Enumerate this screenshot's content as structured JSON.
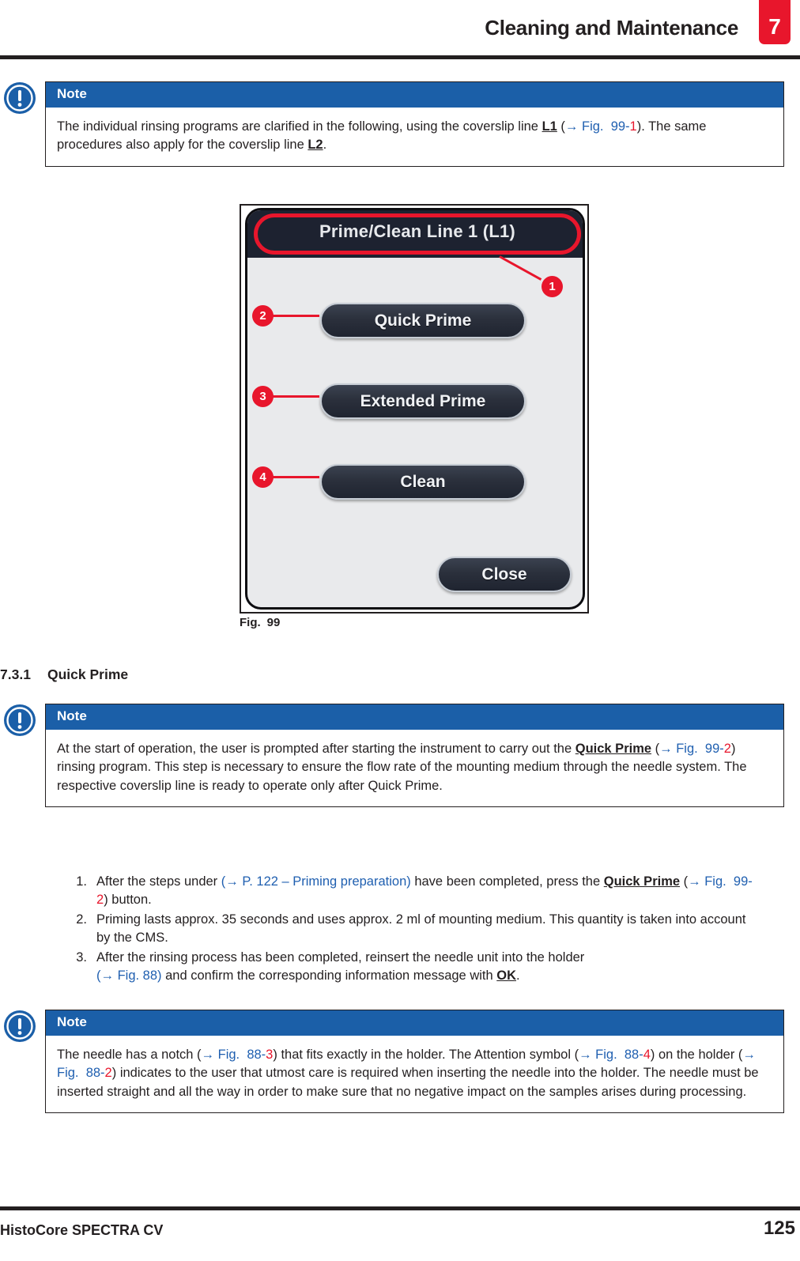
{
  "header": {
    "title": "Cleaning and Maintenance",
    "chapter_number": "7",
    "accent_red": "#e8162c"
  },
  "note_1": {
    "icon": "note-info-icon",
    "label": "Note",
    "text_parts": {
      "p1": "The individual rinsing programs are clarified in the following, using the coverslip line ",
      "bold1": "L1",
      "p2": " (",
      "xref1_arrow": "→ Fig.",
      "xref1_fig": "99-",
      "xref1_num": "1",
      "p3": "). The same procedures also apply for the coverslip line ",
      "bold2": "L2",
      "p4": "."
    }
  },
  "figure": {
    "caption_label": "Fig.",
    "caption_number": "99",
    "dialog": {
      "title": "Prime/Clean Line 1 (L1)",
      "buttons": [
        {
          "label": "Quick Prime",
          "callout": "2"
        },
        {
          "label": "Extended Prime",
          "callout": "3"
        },
        {
          "label": "Clean",
          "callout": "4"
        },
        {
          "label": "Close",
          "callout": ""
        }
      ],
      "title_callout": "1"
    }
  },
  "section": {
    "number": "7.3.1",
    "title": "Quick Prime"
  },
  "note_2": {
    "icon": "note-info-icon",
    "label": "Note",
    "text_parts": {
      "p1": "At the start of operation, the user is prompted after starting the instrument to carry out the ",
      "bold1": "Quick Prime",
      "p2": " (",
      "xref_arrow": "→ Fig.",
      "xref_fig": "99-",
      "xref_num": "2",
      "p3": ") rinsing program. This step is necessary to ensure the flow rate of the mounting medium through the needle system. The respective coverslip line is ready to operate only after Quick Prime."
    }
  },
  "procedure": {
    "items": [
      {
        "num": "1.",
        "p1": "After the steps under ",
        "xref_full": "(→ P. 122 – Priming preparation)",
        "p2": " have been completed, press the ",
        "bold": "Quick Prime",
        "p3": " (",
        "xref_arrow": "→ Fig.",
        "xref_fig": "99-",
        "xref_num": "2",
        "p4": ") button."
      },
      {
        "num": "2.",
        "p1": "Priming lasts approx. 35 seconds and uses approx. 2 ml of mounting medium. This quantity is taken into account by the CMS."
      },
      {
        "num": "3.",
        "p1": "After the rinsing process has been completed, reinsert the needle unit into the holder ",
        "xref_full": "(→ Fig.  88)",
        "p2": " and confirm the corresponding information message with ",
        "bold": "OK",
        "p3": "."
      }
    ]
  },
  "note_3": {
    "icon": "note-info-icon",
    "label": "Note",
    "text_parts": {
      "p1": "The needle has a notch (",
      "x1_arrow": "→ Fig.",
      "x1_fig": "88-",
      "x1_num": "3",
      "p2": ") that fits exactly in the holder. The Attention symbol (",
      "x2_arrow": "→ Fig.",
      "x2_fig": "88-",
      "x2_num": "4",
      "p3": ") on the holder (",
      "x3_arrow": "→ Fig.",
      "x3_fig": "88-",
      "x3_num": "2",
      "p4": ") indicates to the user that utmost care is required when inserting the needle into the holder. The needle must be inserted straight and all the way in order to make sure that no negative impact on the samples arises during processing."
    }
  },
  "footer": {
    "product": "HistoCore SPECTRA CV",
    "page_number": "125"
  }
}
